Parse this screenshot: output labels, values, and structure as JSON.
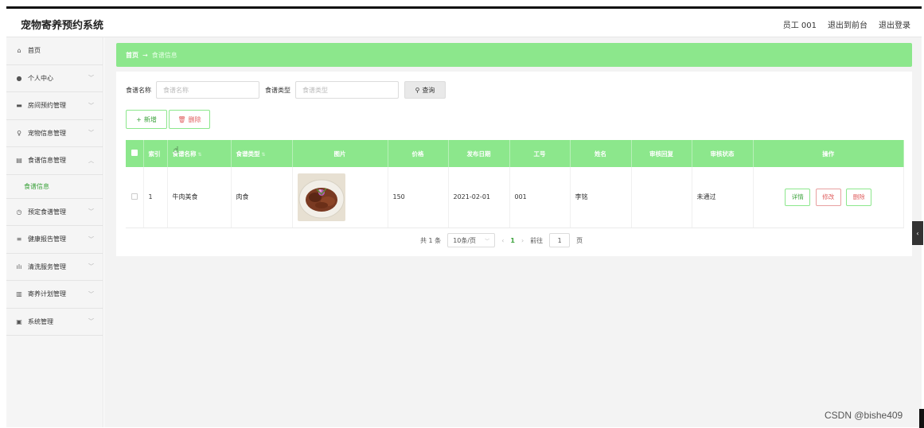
{
  "app": {
    "title": "宠物寄养预约系统"
  },
  "header": {
    "user": "员工 001",
    "back_front": "退出到前台",
    "logout": "退出登录"
  },
  "sidebar": {
    "items": [
      {
        "label": "首页",
        "icon": "home-icon",
        "has_chevron": false
      },
      {
        "label": "个人中心",
        "icon": "user-icon",
        "has_chevron": true
      },
      {
        "label": "房间预约管理",
        "icon": "card-icon",
        "has_chevron": true
      },
      {
        "label": "宠物信息管理",
        "icon": "mic-icon",
        "has_chevron": true
      },
      {
        "label": "食谱信息管理",
        "icon": "book-icon",
        "has_chevron": true,
        "expanded": true,
        "sub": "食谱信息"
      },
      {
        "label": "预定食谱管理",
        "icon": "clock-icon",
        "has_chevron": true
      },
      {
        "label": "健康报告管理",
        "icon": "menu-icon",
        "has_chevron": true
      },
      {
        "label": "清洗服务管理",
        "icon": "bar-chart-icon",
        "has_chevron": true
      },
      {
        "label": "寄养计划管理",
        "icon": "chart-icon",
        "has_chevron": true
      },
      {
        "label": "系统管理",
        "icon": "clipboard-icon",
        "has_chevron": true
      }
    ]
  },
  "breadcrumb": {
    "home": "首页",
    "arrow": "→",
    "current": "食谱信息"
  },
  "search": {
    "name_label": "食谱名称",
    "name_placeholder": "食谱名称",
    "type_label": "食谱类型",
    "type_placeholder": "食谱类型",
    "button": "查询"
  },
  "actions": {
    "add": "新增",
    "delete": "删除"
  },
  "table": {
    "headers": [
      "索引",
      "食谱名称",
      "食谱类型",
      "图片",
      "价格",
      "发布日期",
      "工号",
      "姓名",
      "审核回复",
      "审核状态",
      "操作"
    ],
    "rows": [
      {
        "index": "1",
        "name": "牛肉美食",
        "type": "肉食",
        "price": "150",
        "date": "2021-02-01",
        "staff_id": "001",
        "staff_name": "李铭",
        "reply": "",
        "status": "未通过"
      }
    ],
    "row_ops": {
      "detail": "详情",
      "edit": "修改",
      "delete": "删除"
    }
  },
  "pager": {
    "total": "共 1 条",
    "size": "10条/页",
    "current": "1",
    "goto_label": "前往",
    "goto_value": "1",
    "page_suffix": "页"
  },
  "watermark": "CSDN @bishe409",
  "colors": {
    "accent": "#8ce78c",
    "accent_text": "#3ba23b",
    "danger": "#e06060"
  }
}
